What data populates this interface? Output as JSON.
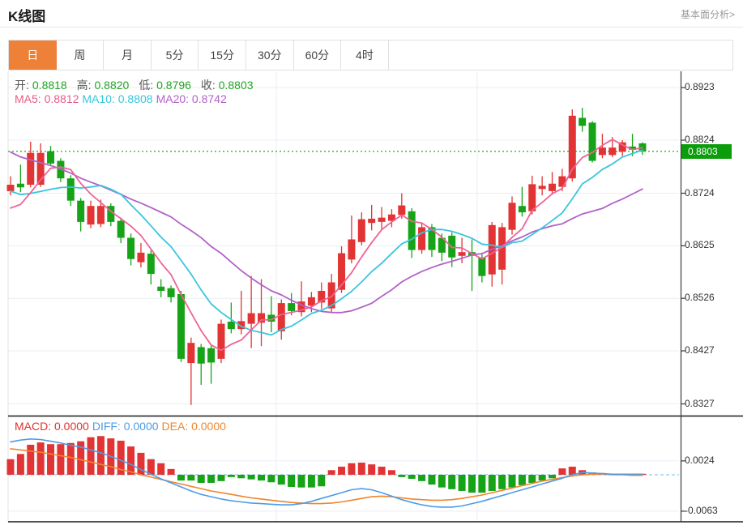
{
  "header": {
    "title": "K线图",
    "analysis_link": "基本面分析>"
  },
  "tabs": {
    "selected_index": 0,
    "items": [
      "日",
      "周",
      "月",
      "5分",
      "15分",
      "30分",
      "60分",
      "4时"
    ]
  },
  "ohlc_legend": {
    "open_label": "开:",
    "open": "0.8818",
    "high_label": "高:",
    "high": "0.8820",
    "low_label": "低:",
    "low": "0.8796",
    "close_label": "收:",
    "close": "0.8803",
    "value_color": "#21a521"
  },
  "ma_legend": [
    {
      "label": "MA5:",
      "value": "0.8812",
      "color": "#e85d87"
    },
    {
      "label": "MA10:",
      "value": "0.8808",
      "color": "#39c5de"
    },
    {
      "label": "MA20:",
      "value": "0.8742",
      "color": "#b162c8"
    }
  ],
  "macd_legend": [
    {
      "label": "MACD:",
      "value": "0.0000",
      "color": "#e23030"
    },
    {
      "label": "DIFF:",
      "value": "0.0000",
      "color": "#4e9ce5"
    },
    {
      "label": "DEA:",
      "value": "0.0000",
      "color": "#f0852e"
    }
  ],
  "price_axis": {
    "labels": [
      {
        "text": "0.8923",
        "value": 0.8923
      },
      {
        "text": "0.8824",
        "value": 0.8824
      },
      {
        "text": "0.8724",
        "value": 0.8724
      },
      {
        "text": "0.8625",
        "value": 0.8625
      },
      {
        "text": "0.8526",
        "value": 0.8526
      },
      {
        "text": "0.8427",
        "value": 0.8427
      },
      {
        "text": "0.8327",
        "value": 0.8327
      }
    ],
    "current": {
      "text": "0.8803",
      "value": 0.8803,
      "bg": "#0b9d0b"
    }
  },
  "macd_axis": {
    "labels": [
      {
        "text": "0.0024",
        "value": 0.0024
      },
      {
        "text": "-0.0063",
        "value": -0.0063
      }
    ]
  },
  "colors": {
    "up": "#e23434",
    "down": "#17a317",
    "grid": "#e9eef5",
    "dotted_line": "#44bb44",
    "axis_line": "#3a3a3a",
    "separator": "#1a1a1a",
    "zero_dash": "#90c8ea",
    "ma5": "#ee6395",
    "ma10": "#39c5de",
    "ma20": "#b162c8",
    "diff": "#4e9ce5",
    "dea": "#f0852e"
  },
  "chart_data": {
    "type": "candlestick",
    "title": "K线图 daily candlesticks with MA5/MA10/MA20 overlay and MACD sub-chart",
    "legend_position": "top-left",
    "grid": true,
    "price_axis_ticks": [
      0.8923,
      0.8824,
      0.8724,
      0.8625,
      0.8526,
      0.8427,
      0.8327
    ],
    "current_price": 0.8803,
    "ohlc_readout": {
      "open": 0.8818,
      "high": 0.882,
      "low": 0.8796,
      "close": 0.8803
    },
    "ma_readout": {
      "ma5": 0.8812,
      "ma10": 0.8808,
      "ma20": 0.8742
    },
    "candles": [
      [
        0.8728,
        0.8756,
        0.872,
        0.874
      ],
      [
        0.8742,
        0.8778,
        0.8726,
        0.8735
      ],
      [
        0.874,
        0.8821,
        0.8735,
        0.88
      ],
      [
        0.874,
        0.8818,
        0.8736,
        0.88
      ],
      [
        0.8803,
        0.8813,
        0.8775,
        0.878
      ],
      [
        0.8785,
        0.879,
        0.8745,
        0.8752
      ],
      [
        0.8752,
        0.8758,
        0.87,
        0.871
      ],
      [
        0.871,
        0.8715,
        0.8652,
        0.867
      ],
      [
        0.8665,
        0.871,
        0.8658,
        0.87
      ],
      [
        0.8666,
        0.8712,
        0.866,
        0.87
      ],
      [
        0.87,
        0.8705,
        0.8662,
        0.867
      ],
      [
        0.8672,
        0.8678,
        0.863,
        0.864
      ],
      [
        0.864,
        0.8648,
        0.8588,
        0.86
      ],
      [
        0.8594,
        0.863,
        0.8584,
        0.8612
      ],
      [
        0.861,
        0.8616,
        0.8552,
        0.8572
      ],
      [
        0.8548,
        0.8562,
        0.8528,
        0.854
      ],
      [
        0.8545,
        0.855,
        0.8518,
        0.8528
      ],
      [
        0.8534,
        0.854,
        0.8406,
        0.8412
      ],
      [
        0.8404,
        0.8452,
        0.8325,
        0.8442
      ],
      [
        0.8434,
        0.844,
        0.8363,
        0.8403
      ],
      [
        0.8432,
        0.8438,
        0.8365,
        0.8405
      ],
      [
        0.8412,
        0.8486,
        0.8404,
        0.8478
      ],
      [
        0.8482,
        0.8518,
        0.846,
        0.8468
      ],
      [
        0.8468,
        0.854,
        0.8458,
        0.8483
      ],
      [
        0.8478,
        0.8568,
        0.8432,
        0.8498
      ],
      [
        0.848,
        0.8562,
        0.8436,
        0.8498
      ],
      [
        0.8495,
        0.853,
        0.8462,
        0.8482
      ],
      [
        0.8464,
        0.8524,
        0.8448,
        0.8517
      ],
      [
        0.8517,
        0.8536,
        0.8494,
        0.8502
      ],
      [
        0.85,
        0.8558,
        0.8492,
        0.852
      ],
      [
        0.8512,
        0.8538,
        0.85,
        0.8528
      ],
      [
        0.8518,
        0.8556,
        0.8506,
        0.854
      ],
      [
        0.8507,
        0.8572,
        0.8498,
        0.8556
      ],
      [
        0.8542,
        0.8624,
        0.8536,
        0.8611
      ],
      [
        0.8599,
        0.8682,
        0.8592,
        0.8637
      ],
      [
        0.8632,
        0.8688,
        0.8626,
        0.8675
      ],
      [
        0.8668,
        0.8702,
        0.8654,
        0.8676
      ],
      [
        0.867,
        0.8698,
        0.8656,
        0.8678
      ],
      [
        0.8672,
        0.8694,
        0.866,
        0.8684
      ],
      [
        0.8683,
        0.8724,
        0.8676,
        0.8701
      ],
      [
        0.869,
        0.8696,
        0.8602,
        0.8617
      ],
      [
        0.8617,
        0.8668,
        0.861,
        0.866
      ],
      [
        0.866,
        0.8666,
        0.8604,
        0.8617
      ],
      [
        0.864,
        0.8648,
        0.8596,
        0.8612
      ],
      [
        0.8644,
        0.865,
        0.8585,
        0.8603
      ],
      [
        0.8606,
        0.864,
        0.8592,
        0.8613
      ],
      [
        0.8613,
        0.8637,
        0.854,
        0.8606
      ],
      [
        0.8603,
        0.861,
        0.8556,
        0.8568
      ],
      [
        0.8571,
        0.867,
        0.8548,
        0.8664
      ],
      [
        0.858,
        0.8668,
        0.8552,
        0.866
      ],
      [
        0.8655,
        0.8718,
        0.8646,
        0.8706
      ],
      [
        0.87,
        0.8736,
        0.868,
        0.8688
      ],
      [
        0.869,
        0.8757,
        0.8684,
        0.8741
      ],
      [
        0.8732,
        0.8756,
        0.872,
        0.8738
      ],
      [
        0.8728,
        0.8764,
        0.8722,
        0.8742
      ],
      [
        0.8736,
        0.877,
        0.8728,
        0.8756
      ],
      [
        0.8752,
        0.8882,
        0.8746,
        0.887
      ],
      [
        0.8866,
        0.8885,
        0.884,
        0.8851
      ],
      [
        0.8857,
        0.886,
        0.8782,
        0.8785
      ],
      [
        0.8796,
        0.8836,
        0.879,
        0.881
      ],
      [
        0.8796,
        0.883,
        0.8792,
        0.881
      ],
      [
        0.8802,
        0.8824,
        0.8794,
        0.882
      ],
      [
        0.8812,
        0.8836,
        0.8794,
        0.8806
      ],
      [
        0.8818,
        0.882,
        0.8796,
        0.8803
      ]
    ],
    "ma_periods": [
      5,
      10,
      20
    ],
    "ma_seed_closes": [
      0.892,
      0.891,
      0.89,
      0.889,
      0.888,
      0.887,
      0.886,
      0.885,
      0.884,
      0.883,
      0.88,
      0.878,
      0.876,
      0.874,
      0.872,
      0.87,
      0.869,
      0.868,
      0.867
    ],
    "macd": {
      "axis_ticks": [
        0.0024,
        -0.0063
      ],
      "hist": [
        0.0027,
        0.0036,
        0.0052,
        0.0056,
        0.0053,
        0.0053,
        0.0055,
        0.0058,
        0.0065,
        0.0067,
        0.0063,
        0.0059,
        0.0049,
        0.0038,
        0.0027,
        0.002,
        0.001,
        -0.001,
        -0.001,
        -0.0014,
        -0.0014,
        -0.0011,
        -0.0004,
        -0.0006,
        -0.0008,
        -0.001,
        -0.0013,
        -0.0017,
        -0.0021,
        -0.0022,
        -0.0022,
        -0.002,
        0.0008,
        0.0014,
        0.002,
        0.0021,
        0.0018,
        0.0014,
        0.0008,
        -0.0004,
        -0.0007,
        -0.0011,
        -0.0017,
        -0.0022,
        -0.0025,
        -0.0028,
        -0.0031,
        -0.0031,
        -0.0028,
        -0.0025,
        -0.0022,
        -0.0018,
        -0.0014,
        -0.001,
        -0.0006,
        0.0011,
        0.0014,
        0.0008,
        0.0004,
        0.0003,
        0.0002,
        0.0001,
        -0.0001,
        0.0001
      ],
      "diff": [
        0.0057,
        0.006,
        0.0062,
        0.0061,
        0.0058,
        0.0055,
        0.0051,
        0.0048,
        0.0043,
        0.0038,
        0.0032,
        0.0025,
        0.0018,
        0.0009,
        0.0001,
        -0.0007,
        -0.0014,
        -0.0021,
        -0.0028,
        -0.0034,
        -0.0038,
        -0.0042,
        -0.0045,
        -0.0047,
        -0.0049,
        -0.005,
        -0.0051,
        -0.0052,
        -0.0052,
        -0.005,
        -0.0046,
        -0.0041,
        -0.0036,
        -0.0031,
        -0.0026,
        -0.0024,
        -0.0026,
        -0.0031,
        -0.0037,
        -0.0043,
        -0.0048,
        -0.0052,
        -0.0055,
        -0.0056,
        -0.0056,
        -0.0054,
        -0.005,
        -0.0046,
        -0.0041,
        -0.0036,
        -0.0031,
        -0.0026,
        -0.0021,
        -0.0016,
        -0.0011,
        -0.0006,
        0.0,
        0.0004,
        0.0003,
        0.0002,
        0.0001,
        0.0001,
        0.0001,
        0.0001
      ],
      "dea": [
        0.0045,
        0.0043,
        0.0041,
        0.0039,
        0.0036,
        0.0033,
        0.003,
        0.0026,
        0.0022,
        0.0018,
        0.0014,
        0.0009,
        0.0005,
        0.0,
        -0.0004,
        -0.0008,
        -0.0012,
        -0.0016,
        -0.002,
        -0.0024,
        -0.0028,
        -0.0031,
        -0.0034,
        -0.0037,
        -0.004,
        -0.0042,
        -0.0044,
        -0.0046,
        -0.0048,
        -0.0049,
        -0.005,
        -0.005,
        -0.0049,
        -0.0047,
        -0.0044,
        -0.0041,
        -0.0038,
        -0.0037,
        -0.0038,
        -0.004,
        -0.0042,
        -0.0043,
        -0.0044,
        -0.0044,
        -0.0043,
        -0.0041,
        -0.0038,
        -0.0035,
        -0.0031,
        -0.0027,
        -0.0023,
        -0.0019,
        -0.0015,
        -0.0011,
        -0.0008,
        -0.0005,
        -0.0002,
        0.0,
        0.0001,
        0.0001,
        0.0,
        0.0,
        -0.0001,
        -0.0001
      ]
    }
  }
}
